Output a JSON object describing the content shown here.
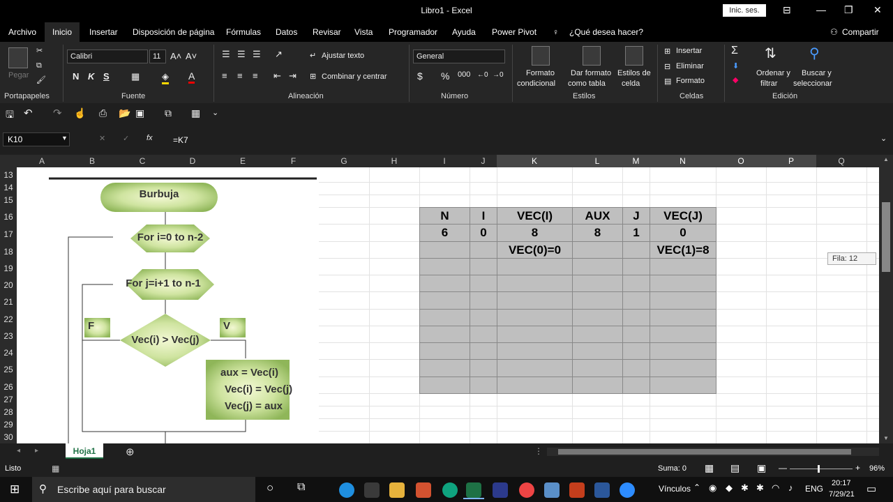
{
  "window": {
    "title": "Libro1  -  Excel",
    "signin": "Inic. ses."
  },
  "menu": {
    "items": [
      "Archivo",
      "Inicio",
      "Insertar",
      "Disposición de página",
      "Fórmulas",
      "Datos",
      "Revisar",
      "Vista",
      "Programador",
      "Ayuda",
      "Power Pivot"
    ],
    "search": "¿Qué desea hacer?",
    "share": "Compartir"
  },
  "ribbon": {
    "font_name": "Calibri",
    "font_size": "11",
    "paste": "Pegar",
    "wrap_text": "Ajustar texto",
    "merge": "Combinar y centrar",
    "number_format": "General",
    "cond_format": [
      "Formato",
      "condicional"
    ],
    "table_format": [
      "Dar formato",
      "como tabla"
    ],
    "cell_styles": [
      "Estilos de",
      "celda"
    ],
    "insert": "Insertar",
    "delete": "Eliminar",
    "format": "Formato",
    "sort": [
      "Ordenar y",
      "filtrar"
    ],
    "find": [
      "Buscar y",
      "seleccionar"
    ],
    "groups": [
      "Portapapeles",
      "Fuente",
      "Alineación",
      "Número",
      "Estilos",
      "Celdas",
      "Edición"
    ]
  },
  "formula_bar": {
    "name_box": "K10",
    "formula": "=K7"
  },
  "columns": [
    "A",
    "B",
    "C",
    "D",
    "E",
    "F",
    "G",
    "H",
    "I",
    "J",
    "K",
    "L",
    "M",
    "N",
    "O",
    "P",
    "Q"
  ],
  "rows": [
    "13",
    "14",
    "15",
    "16",
    "17",
    "18",
    "19",
    "20",
    "21",
    "22",
    "23",
    "24",
    "25",
    "26",
    "27",
    "28",
    "29",
    "30"
  ],
  "flowchart": {
    "start": "Burbuja",
    "loop1": "For i=0 to n-2",
    "loop2": "For j=i+1 to n-1",
    "condition": "Vec(i) > Vec(j)",
    "false_label": "F",
    "true_label": "V",
    "swap": [
      "aux = Vec(i)",
      "Vec(i) = Vec(j)",
      "Vec(j) = aux"
    ]
  },
  "table": {
    "headers": [
      "N",
      "I",
      "VEC(I)",
      "AUX",
      "J",
      "VEC(J)"
    ],
    "row1": [
      "6",
      "0",
      "8",
      "8",
      "1",
      "0"
    ],
    "row2": [
      "",
      "",
      "VEC(0)=0",
      "",
      "",
      "VEC(1)=8"
    ]
  },
  "tooltip": "Fila: 12",
  "sheet_tab": "Hoja1",
  "status": {
    "ready": "Listo",
    "sum": "Suma: 0",
    "zoom": "96%"
  },
  "taskbar": {
    "search": "Escribe aquí para buscar",
    "links": "Vínculos",
    "lang": "ENG",
    "time": "20:17",
    "date": "7/29/21"
  }
}
